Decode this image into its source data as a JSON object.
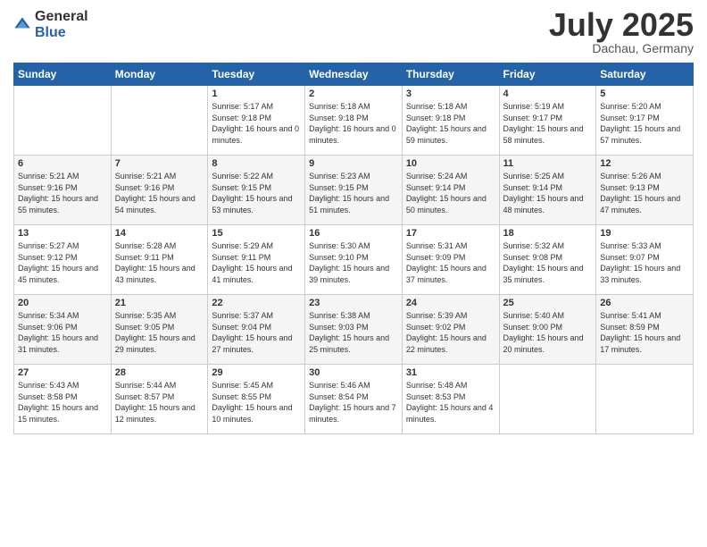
{
  "logo": {
    "general": "General",
    "blue": "Blue"
  },
  "title": "July 2025",
  "subtitle": "Dachau, Germany",
  "days_header": [
    "Sunday",
    "Monday",
    "Tuesday",
    "Wednesday",
    "Thursday",
    "Friday",
    "Saturday"
  ],
  "weeks": [
    [
      {
        "day": "",
        "sunrise": "",
        "sunset": "",
        "daylight": ""
      },
      {
        "day": "",
        "sunrise": "",
        "sunset": "",
        "daylight": ""
      },
      {
        "day": "1",
        "sunrise": "Sunrise: 5:17 AM",
        "sunset": "Sunset: 9:18 PM",
        "daylight": "Daylight: 16 hours and 0 minutes."
      },
      {
        "day": "2",
        "sunrise": "Sunrise: 5:18 AM",
        "sunset": "Sunset: 9:18 PM",
        "daylight": "Daylight: 16 hours and 0 minutes."
      },
      {
        "day": "3",
        "sunrise": "Sunrise: 5:18 AM",
        "sunset": "Sunset: 9:18 PM",
        "daylight": "Daylight: 15 hours and 59 minutes."
      },
      {
        "day": "4",
        "sunrise": "Sunrise: 5:19 AM",
        "sunset": "Sunset: 9:17 PM",
        "daylight": "Daylight: 15 hours and 58 minutes."
      },
      {
        "day": "5",
        "sunrise": "Sunrise: 5:20 AM",
        "sunset": "Sunset: 9:17 PM",
        "daylight": "Daylight: 15 hours and 57 minutes."
      }
    ],
    [
      {
        "day": "6",
        "sunrise": "Sunrise: 5:21 AM",
        "sunset": "Sunset: 9:16 PM",
        "daylight": "Daylight: 15 hours and 55 minutes."
      },
      {
        "day": "7",
        "sunrise": "Sunrise: 5:21 AM",
        "sunset": "Sunset: 9:16 PM",
        "daylight": "Daylight: 15 hours and 54 minutes."
      },
      {
        "day": "8",
        "sunrise": "Sunrise: 5:22 AM",
        "sunset": "Sunset: 9:15 PM",
        "daylight": "Daylight: 15 hours and 53 minutes."
      },
      {
        "day": "9",
        "sunrise": "Sunrise: 5:23 AM",
        "sunset": "Sunset: 9:15 PM",
        "daylight": "Daylight: 15 hours and 51 minutes."
      },
      {
        "day": "10",
        "sunrise": "Sunrise: 5:24 AM",
        "sunset": "Sunset: 9:14 PM",
        "daylight": "Daylight: 15 hours and 50 minutes."
      },
      {
        "day": "11",
        "sunrise": "Sunrise: 5:25 AM",
        "sunset": "Sunset: 9:14 PM",
        "daylight": "Daylight: 15 hours and 48 minutes."
      },
      {
        "day": "12",
        "sunrise": "Sunrise: 5:26 AM",
        "sunset": "Sunset: 9:13 PM",
        "daylight": "Daylight: 15 hours and 47 minutes."
      }
    ],
    [
      {
        "day": "13",
        "sunrise": "Sunrise: 5:27 AM",
        "sunset": "Sunset: 9:12 PM",
        "daylight": "Daylight: 15 hours and 45 minutes."
      },
      {
        "day": "14",
        "sunrise": "Sunrise: 5:28 AM",
        "sunset": "Sunset: 9:11 PM",
        "daylight": "Daylight: 15 hours and 43 minutes."
      },
      {
        "day": "15",
        "sunrise": "Sunrise: 5:29 AM",
        "sunset": "Sunset: 9:11 PM",
        "daylight": "Daylight: 15 hours and 41 minutes."
      },
      {
        "day": "16",
        "sunrise": "Sunrise: 5:30 AM",
        "sunset": "Sunset: 9:10 PM",
        "daylight": "Daylight: 15 hours and 39 minutes."
      },
      {
        "day": "17",
        "sunrise": "Sunrise: 5:31 AM",
        "sunset": "Sunset: 9:09 PM",
        "daylight": "Daylight: 15 hours and 37 minutes."
      },
      {
        "day": "18",
        "sunrise": "Sunrise: 5:32 AM",
        "sunset": "Sunset: 9:08 PM",
        "daylight": "Daylight: 15 hours and 35 minutes."
      },
      {
        "day": "19",
        "sunrise": "Sunrise: 5:33 AM",
        "sunset": "Sunset: 9:07 PM",
        "daylight": "Daylight: 15 hours and 33 minutes."
      }
    ],
    [
      {
        "day": "20",
        "sunrise": "Sunrise: 5:34 AM",
        "sunset": "Sunset: 9:06 PM",
        "daylight": "Daylight: 15 hours and 31 minutes."
      },
      {
        "day": "21",
        "sunrise": "Sunrise: 5:35 AM",
        "sunset": "Sunset: 9:05 PM",
        "daylight": "Daylight: 15 hours and 29 minutes."
      },
      {
        "day": "22",
        "sunrise": "Sunrise: 5:37 AM",
        "sunset": "Sunset: 9:04 PM",
        "daylight": "Daylight: 15 hours and 27 minutes."
      },
      {
        "day": "23",
        "sunrise": "Sunrise: 5:38 AM",
        "sunset": "Sunset: 9:03 PM",
        "daylight": "Daylight: 15 hours and 25 minutes."
      },
      {
        "day": "24",
        "sunrise": "Sunrise: 5:39 AM",
        "sunset": "Sunset: 9:02 PM",
        "daylight": "Daylight: 15 hours and 22 minutes."
      },
      {
        "day": "25",
        "sunrise": "Sunrise: 5:40 AM",
        "sunset": "Sunset: 9:00 PM",
        "daylight": "Daylight: 15 hours and 20 minutes."
      },
      {
        "day": "26",
        "sunrise": "Sunrise: 5:41 AM",
        "sunset": "Sunset: 8:59 PM",
        "daylight": "Daylight: 15 hours and 17 minutes."
      }
    ],
    [
      {
        "day": "27",
        "sunrise": "Sunrise: 5:43 AM",
        "sunset": "Sunset: 8:58 PM",
        "daylight": "Daylight: 15 hours and 15 minutes."
      },
      {
        "day": "28",
        "sunrise": "Sunrise: 5:44 AM",
        "sunset": "Sunset: 8:57 PM",
        "daylight": "Daylight: 15 hours and 12 minutes."
      },
      {
        "day": "29",
        "sunrise": "Sunrise: 5:45 AM",
        "sunset": "Sunset: 8:55 PM",
        "daylight": "Daylight: 15 hours and 10 minutes."
      },
      {
        "day": "30",
        "sunrise": "Sunrise: 5:46 AM",
        "sunset": "Sunset: 8:54 PM",
        "daylight": "Daylight: 15 hours and 7 minutes."
      },
      {
        "day": "31",
        "sunrise": "Sunrise: 5:48 AM",
        "sunset": "Sunset: 8:53 PM",
        "daylight": "Daylight: 15 hours and 4 minutes."
      },
      {
        "day": "",
        "sunrise": "",
        "sunset": "",
        "daylight": ""
      },
      {
        "day": "",
        "sunrise": "",
        "sunset": "",
        "daylight": ""
      }
    ]
  ]
}
